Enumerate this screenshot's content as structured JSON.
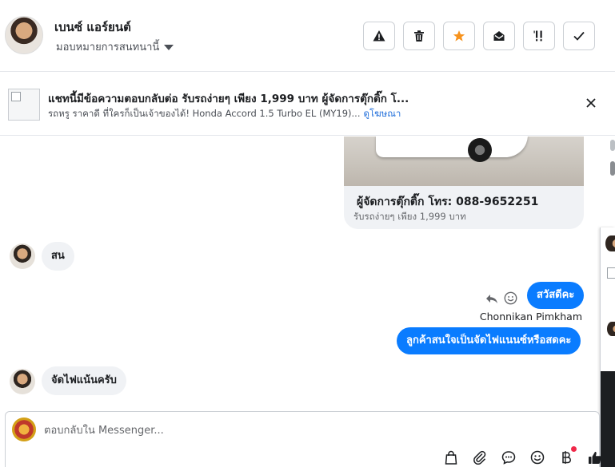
{
  "header": {
    "contact_name": "เบนซ์ แอร์ยนต์",
    "assign_label": "มอบหมายการสนทนานี้",
    "actions": [
      {
        "name": "report-icon"
      },
      {
        "name": "trash-icon"
      },
      {
        "name": "star-icon",
        "color": "#f7931e"
      },
      {
        "name": "mark-unread-icon"
      },
      {
        "name": "follow-up-icon"
      },
      {
        "name": "done-check-icon"
      }
    ]
  },
  "banner": {
    "title": "แชทนี้มีข้อความตอบกลับต่อ รับรถง่ายๆ เพียง 1,999 บาท ผู้จัดการตุ๊กติ๊ก โ...",
    "subtitle": "รถหรู ราคาดี ที่ใครก็เป็นเจ้าของได้! Honda Accord 1.5 Turbo EL (MY19)...",
    "link": "ดูโฆษณา"
  },
  "chat": {
    "card": {
      "title": "ผู้จัดการตุ๊กติ๊ก โทร: 088-9652251",
      "subtitle": "รับรถง่ายๆ เพียง 1,999 บาท"
    },
    "messages": [
      {
        "from": "contact",
        "text": "สน"
      },
      {
        "from": "page",
        "text": "สวัสดีคะ"
      },
      {
        "from": "page_sender",
        "text": "Chonnikan Pimkham"
      },
      {
        "from": "page",
        "text": "ลูกค้าสนใจเป็นจัดไฟแนนซ์หรือสดคะ"
      },
      {
        "from": "contact",
        "text": "จัดไฟแน้นครับ"
      }
    ]
  },
  "composer": {
    "placeholder": "ตอบกลับใน Messenger...",
    "tools": [
      "shopping-bag-icon",
      "paperclip-icon",
      "saved-reply-icon",
      "emoji-icon",
      "baht-payment-icon",
      "thumbs-up-icon"
    ],
    "accent": "#0a7cff"
  }
}
